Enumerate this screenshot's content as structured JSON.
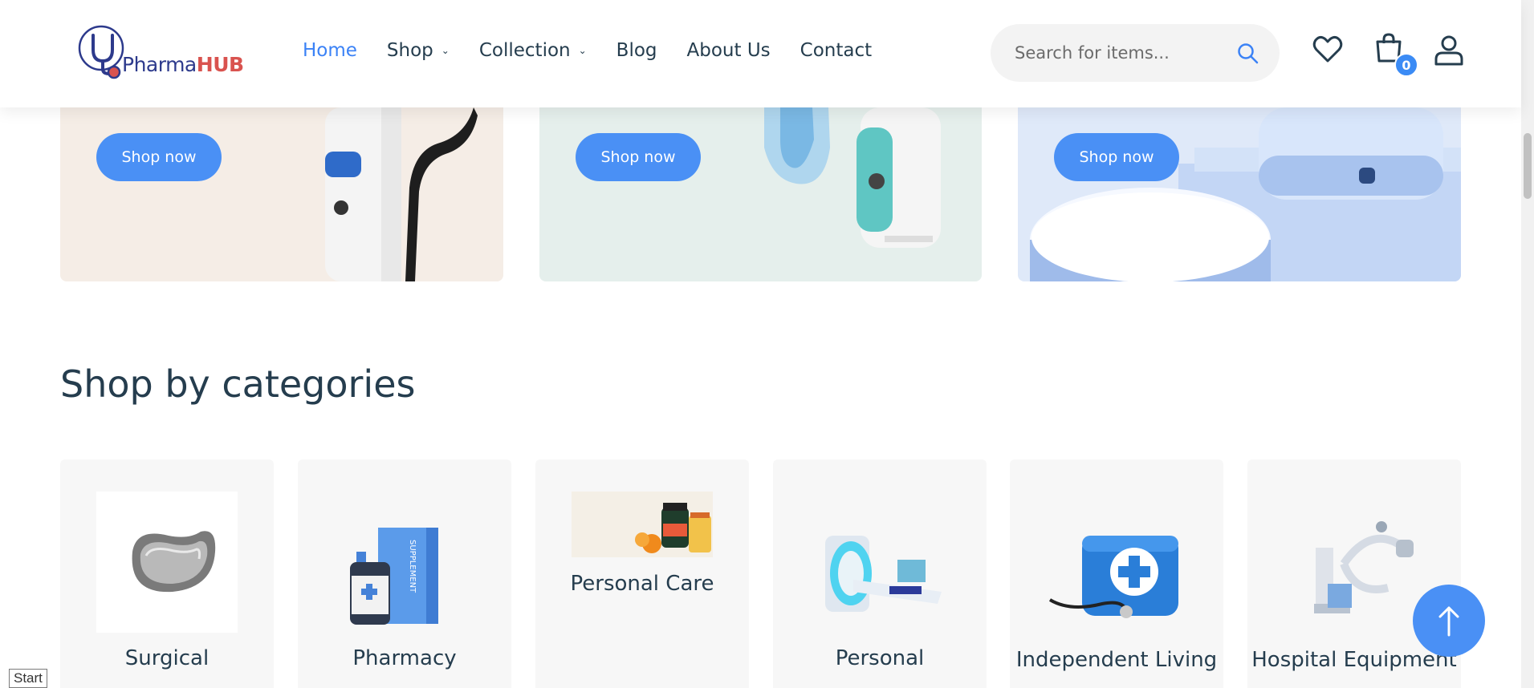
{
  "brand": {
    "name_part1": "Pharma",
    "name_part2": "HUB",
    "primary_color": "#3b82f6",
    "accent_color": "#d9534f"
  },
  "nav": {
    "items": [
      {
        "label": "Home",
        "active": true,
        "dropdown": false
      },
      {
        "label": "Shop",
        "active": false,
        "dropdown": true
      },
      {
        "label": "Collection",
        "active": false,
        "dropdown": true
      },
      {
        "label": "Blog",
        "active": false,
        "dropdown": false
      },
      {
        "label": "About Us",
        "active": false,
        "dropdown": false
      },
      {
        "label": "Contact",
        "active": false,
        "dropdown": false
      }
    ]
  },
  "search": {
    "placeholder": "Search for items...",
    "icon": "search-icon"
  },
  "header_icons": {
    "wishlist": "heart-icon",
    "cart": "cart-icon",
    "cart_count": "0",
    "account": "user-icon"
  },
  "banners": [
    {
      "button_label": "Shop now",
      "bg": "#f5ede6"
    },
    {
      "button_label": "Shop now",
      "bg": "#e5efec"
    },
    {
      "button_label": "Shop now",
      "bg": "#dfe9f9"
    }
  ],
  "categories": {
    "title": "Shop by categories",
    "items": [
      {
        "label": "Surgical"
      },
      {
        "label": "Pharmacy"
      },
      {
        "label": "Personal Care"
      },
      {
        "label": "Personal"
      },
      {
        "label": "Independent Living"
      },
      {
        "label": "Hospital Equipment"
      }
    ]
  },
  "scroll_top": {
    "icon": "arrow-up-icon"
  },
  "taskbar": {
    "start_label": "Start"
  }
}
